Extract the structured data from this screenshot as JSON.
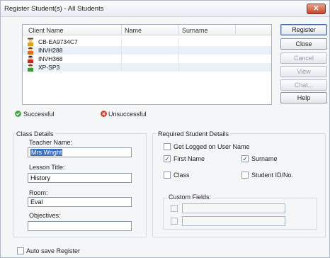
{
  "window": {
    "title": "Register Student(s) - All Students",
    "close_glyph": "✕"
  },
  "list": {
    "columns": [
      "Client Name",
      "Name",
      "Surname"
    ],
    "rows": [
      {
        "client": "CB-EA9734C7",
        "icon": "student-gold-icon"
      },
      {
        "client": "INVH288",
        "icon": "student-orange-icon"
      },
      {
        "client": "INVH368",
        "icon": "student-red-icon"
      },
      {
        "client": "XP-SP3",
        "icon": "student-green-icon"
      }
    ]
  },
  "buttons": {
    "register": "Register",
    "close": "Close",
    "cancel": "Cancel",
    "view": "View",
    "chat": "Chat...",
    "help": "Help"
  },
  "status": {
    "successful": "Successful",
    "unsuccessful": "Unsuccessful",
    "success_color": "#3fa23a",
    "fail_color": "#d03a2a"
  },
  "class_details": {
    "legend": "Class Details",
    "teacher_label": "Teacher Name:",
    "teacher_value": "Mrs Wright",
    "lesson_label": "Lesson Title:",
    "lesson_value": "History",
    "room_label": "Room:",
    "room_value": "Eval",
    "objectives_label": "Objectives:",
    "objectives_value": ""
  },
  "required": {
    "legend": "Required Student Details",
    "get_logged": "Get Logged on User Name",
    "first_name": "First Name",
    "surname": "Surname",
    "class": "Class",
    "student_id": "Student ID/No.",
    "check_mark": "✓"
  },
  "custom_fields": {
    "legend": "Custom Fields:"
  },
  "auto_save": "Auto save Register"
}
